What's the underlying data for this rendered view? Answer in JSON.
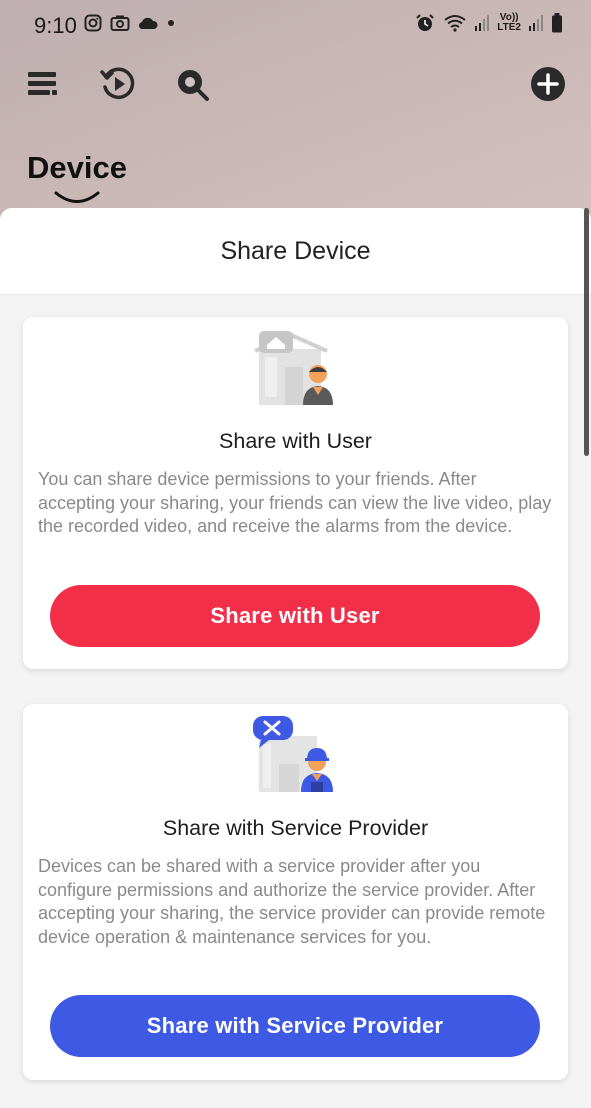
{
  "status_bar": {
    "time": "9:10",
    "network_label_top": "Vo))",
    "network_label_bottom": "LTE2",
    "icons_left": [
      "instagram-icon",
      "camera-icon",
      "cloud-icon",
      "dot-icon"
    ],
    "icons_right": [
      "alarm-icon",
      "wifi-icon",
      "signal-icon",
      "signal-icon",
      "battery-icon"
    ]
  },
  "toolbar": {
    "icons": [
      "menu-icon",
      "playback-icon",
      "search-icon",
      "add-icon"
    ]
  },
  "page": {
    "title": "Device"
  },
  "sheet": {
    "title": "Share Device"
  },
  "cards": [
    {
      "title": "Share with User",
      "description": "You can share device permissions to your friends. After accepting your sharing, your friends can view the live video, play the recorded video, and receive the alarms from the device.",
      "button_label": "Share with User",
      "button_color": "#f22e48"
    },
    {
      "title": "Share with Service Provider",
      "description": "Devices can be shared with a service provider after you configure permissions and authorize the service provider. After accepting your sharing, the service provider can provide remote device operation & maintenance services for you.",
      "button_label": "Share with Service Provider",
      "button_color": "#3e5ae4"
    }
  ],
  "colors": {
    "accent_red": "#f22e48",
    "accent_blue": "#3e5ae4"
  }
}
